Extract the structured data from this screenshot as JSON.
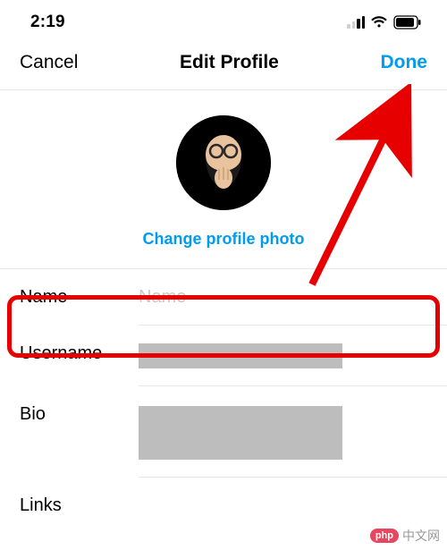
{
  "status": {
    "time": "2:19"
  },
  "nav": {
    "cancel": "Cancel",
    "title": "Edit Profile",
    "done": "Done"
  },
  "profile": {
    "change_photo_label": "Change profile photo"
  },
  "fields": {
    "name": {
      "label": "Name",
      "placeholder": "Name",
      "value": ""
    },
    "username": {
      "label": "Username",
      "value": ""
    },
    "bio": {
      "label": "Bio",
      "value": ""
    },
    "links": {
      "label": "Links",
      "value": ""
    }
  },
  "accent_color": "#009cf0",
  "watermark": {
    "icon_text": "php",
    "text": "中文网"
  }
}
